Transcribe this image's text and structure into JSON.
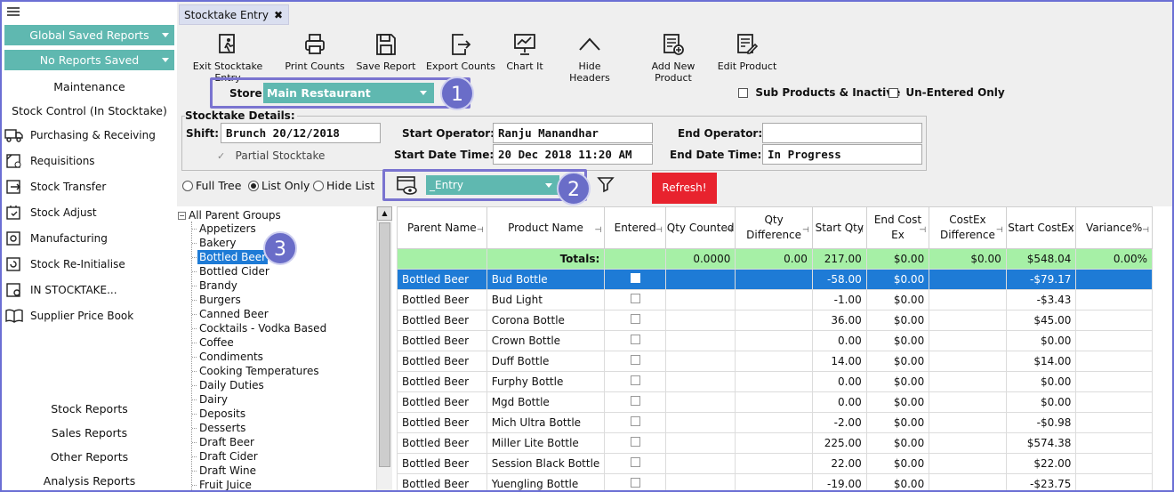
{
  "sidebar": {
    "dropdown_global": "Global Saved Reports",
    "dropdown_saved": "No Reports Saved",
    "maintenance": "Maintenance",
    "stock_control": "Stock Control (In Stocktake)",
    "items": [
      {
        "label": "Purchasing & Receiving",
        "icon": "truck-icon"
      },
      {
        "label": "Requisitions",
        "icon": "requisition-icon"
      },
      {
        "label": "Stock Transfer",
        "icon": "transfer-icon"
      },
      {
        "label": "Stock Adjust",
        "icon": "adjust-icon"
      },
      {
        "label": "Manufacturing",
        "icon": "manufacturing-icon"
      },
      {
        "label": "Stock Re-Initialise",
        "icon": "reinitialise-icon"
      },
      {
        "label": "IN STOCKTAKE...",
        "icon": "stocktake-icon"
      },
      {
        "label": "Supplier Price Book",
        "icon": "book-icon"
      }
    ],
    "reports": [
      "Stock Reports",
      "Sales Reports",
      "Other Reports",
      "Analysis Reports"
    ]
  },
  "tab": {
    "label": "Stocktake Entry",
    "close": "✖"
  },
  "toolbar": [
    {
      "label": "Exit Stocktake Entry",
      "icon": "exit-stocktake-icon"
    },
    {
      "label": "Print Counts",
      "icon": "printer-icon"
    },
    {
      "label": "Save Report",
      "icon": "save-icon"
    },
    {
      "label": "Export Counts",
      "icon": "export-icon"
    },
    {
      "label": "Chart It",
      "icon": "chart-icon"
    },
    {
      "label": "Hide Headers",
      "icon": "chevron-up-icon"
    },
    {
      "label": "Add New Product",
      "icon": "add-product-icon"
    },
    {
      "label": "Edit Product",
      "icon": "edit-product-icon"
    }
  ],
  "store": {
    "label": "Store:",
    "value": "Main Restaurant"
  },
  "callouts": [
    "1",
    "2",
    "3"
  ],
  "options": {
    "sub_products": "Sub Products & Inactive",
    "un_entered": "Un-Entered Only"
  },
  "details": {
    "title": "Stocktake Details:",
    "shift_label": "Shift:",
    "shift_value": "Brunch 20/12/2018",
    "partial_label": "Partial Stocktake",
    "start_operator_label": "Start Operator:",
    "start_operator_value": "Ranju  Manandhar",
    "start_time_label": "Start Date Time:",
    "start_time_value": "20 Dec 2018 11:20 AM",
    "end_operator_label": "End Operator:",
    "end_operator_value": "",
    "end_time_label": "End Date Time:",
    "end_time_value": "In Progress"
  },
  "view": {
    "full_tree": "Full Tree",
    "list_only": "List Only",
    "hide_list": "Hide List",
    "layout_value": "_Entry",
    "refresh": "Refresh!"
  },
  "tree": {
    "root": "All Parent Groups",
    "items": [
      "Appetizers",
      "Bakery",
      "Bottled Beer",
      "Bottled Cider",
      "Brandy",
      "Burgers",
      "Canned Beer",
      "Cocktails - Vodka Based",
      "Coffee",
      "Condiments",
      "Cooking Temperatures",
      "Daily Duties",
      "Dairy",
      "Deposits",
      "Desserts",
      "Draft Beer",
      "Draft Cider",
      "Draft Wine",
      "Fruit Juice"
    ],
    "selected": "Bottled Beer"
  },
  "grid": {
    "headers": [
      "Parent Name",
      "Product Name",
      "Entered",
      "Qty Counted",
      "Qty Difference",
      "Start Qty",
      "End Cost Ex",
      "CostEx Difference",
      "Start CostEx",
      "Variance%"
    ],
    "totals": {
      "label": "Totals:",
      "qty_counted": "0.0000",
      "qty_diff": "0.00",
      "start_qty": "217.00",
      "end_cost": "$0.00",
      "costex_diff": "$0.00",
      "start_costex": "$548.04",
      "variance": "0.00%"
    },
    "rows": [
      [
        "Bottled Beer",
        "Bud Bottle",
        "-58.00",
        "$0.00",
        "-$79.17"
      ],
      [
        "Bottled Beer",
        "Bud Light",
        "-1.00",
        "$0.00",
        "-$3.43"
      ],
      [
        "Bottled Beer",
        "Corona Bottle",
        "36.00",
        "$0.00",
        "$45.00"
      ],
      [
        "Bottled Beer",
        "Crown Bottle",
        "0.00",
        "$0.00",
        "$0.00"
      ],
      [
        "Bottled Beer",
        "Duff Bottle",
        "14.00",
        "$0.00",
        "$14.00"
      ],
      [
        "Bottled Beer",
        "Furphy Bottle",
        "0.00",
        "$0.00",
        "$0.00"
      ],
      [
        "Bottled Beer",
        "Mgd Bottle",
        "0.00",
        "$0.00",
        "$0.00"
      ],
      [
        "Bottled Beer",
        "Mich Ultra Bottle",
        "-2.00",
        "$0.00",
        "-$0.98"
      ],
      [
        "Bottled Beer",
        "Miller Lite Bottle",
        "225.00",
        "$0.00",
        "$574.38"
      ],
      [
        "Bottled Beer",
        "Session Black Bottle",
        "22.00",
        "$0.00",
        "$22.00"
      ],
      [
        "Bottled Beer",
        "Yuengling Bottle",
        "-19.00",
        "$0.00",
        "-$23.75"
      ]
    ]
  },
  "colors": {
    "teal": "#5fb8b0",
    "selection": "#1e7bd6",
    "totals": "#a6f0a6",
    "refresh": "#e8232e",
    "callout": "#6a6dc8"
  }
}
